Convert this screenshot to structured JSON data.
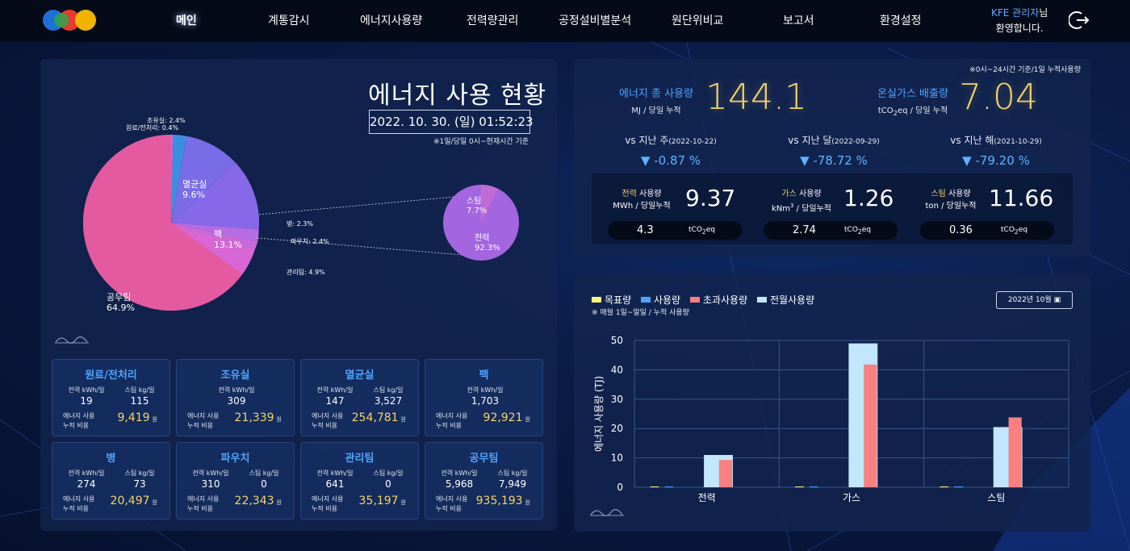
{
  "nav": {
    "items": [
      "메인",
      "계통감시",
      "에너지사용량",
      "전력량관리",
      "공정설비별분석",
      "원단위비교",
      "보고서",
      "환경설정"
    ],
    "active_index": 0
  },
  "user": {
    "name": "KFE 관리자",
    "suffix": "님",
    "greeting": "환영합니다."
  },
  "left_panel": {
    "title": "에너지 사용 현황",
    "date": "2022. 10. 30. (일) 01:52:23",
    "date_note": "※1일/당일 0시~현재시간 기준",
    "pie_labels": {
      "josu": "조유실: 2.4%",
      "wonryo": "원료/전처리: 0.4%",
      "byeong": "병: 2.3%",
      "powchi": "파우치: 2.4%",
      "gwanri": "관리팀: 4.9%",
      "myeol_name": "멸균실",
      "myeol_pct": "9.6%",
      "paek_name": "팩",
      "paek_pct": "13.1%",
      "gongmu_name": "공무팀",
      "gongmu_pct": "64.9%",
      "steam_name": "스팀",
      "steam_pct": "7.7%",
      "power_name": "전력",
      "power_pct": "92.3%"
    },
    "cards": [
      {
        "name": "원료/전처리",
        "power_label": "전력 kWh/일",
        "power": "19",
        "steam_label": "스팀 kg/일",
        "steam": "115",
        "cost_label1": "에너지 사용",
        "cost_label2": "누적 비용",
        "cost": "9,419",
        "won": "원"
      },
      {
        "name": "조유실",
        "power_label": "전력 kWh/일",
        "power": "309",
        "cost_label1": "에너지 사용",
        "cost_label2": "누적 비용",
        "cost": "21,339",
        "won": "원"
      },
      {
        "name": "멸균실",
        "power_label": "전력 kWh/일",
        "power": "147",
        "steam_label": "스팀 kg/일",
        "steam": "3,527",
        "cost_label1": "에너지 사용",
        "cost_label2": "누적 비용",
        "cost": "254,781",
        "won": "원"
      },
      {
        "name": "팩",
        "power_label": "전력 kWh/일",
        "power": "1,703",
        "cost_label1": "에너지 사용",
        "cost_label2": "누적 비용",
        "cost": "92,921",
        "won": "원"
      },
      {
        "name": "병",
        "power_label": "전력 kWh/일",
        "power": "274",
        "steam_label": "스팀 kg/일",
        "steam": "73",
        "cost_label1": "에너지 사용",
        "cost_label2": "누적 비용",
        "cost": "20,497",
        "won": "원"
      },
      {
        "name": "파우치",
        "power_label": "전력 kWh/일",
        "power": "310",
        "steam_label": "스팀 kg/일",
        "steam": "0",
        "cost_label1": "에너지 사용",
        "cost_label2": "누적 비용",
        "cost": "22,343",
        "won": "원"
      },
      {
        "name": "관리팀",
        "power_label": "전력 kWh/일",
        "power": "641",
        "steam_label": "스팀 kg/일",
        "steam": "0",
        "cost_label1": "에너지 사용",
        "cost_label2": "누적 비용",
        "cost": "35,197",
        "won": "원"
      },
      {
        "name": "공무팀",
        "power_label": "전력 kWh/일",
        "power": "5,968",
        "steam_label": "스팀 kg/일",
        "steam": "7,949",
        "cost_label1": "에너지 사용",
        "cost_label2": "누적 비용",
        "cost": "935,193",
        "won": "원"
      }
    ]
  },
  "kpi": {
    "note": "※0시~24시간 기준/1일 누적사용량",
    "total_label": "에너지 총 사용량",
    "total_unit": "MJ / 당일 누적",
    "total_value": "144.1",
    "ghg_label": "온실가스 배출량",
    "ghg_unit_pre": "tCO",
    "ghg_unit_sub": "2",
    "ghg_unit_post": "eq / 당일 누적",
    "ghg_value": "7.04",
    "vs": [
      {
        "label": "vs 지난 주",
        "date": "(2022-10-22)",
        "delta": "▼ -0.87 %"
      },
      {
        "label": "vs 지난 달",
        "date": "(2022-09-29)",
        "delta": "▼ -78.72 %"
      },
      {
        "label": "vs 지난 해",
        "date": "(2021-10-29)",
        "delta": "▼ -79.20 %"
      }
    ],
    "utilities": [
      {
        "name": "전력",
        "suffix": " 사용량",
        "unit": "MWh / 당일누적",
        "value": "9.37",
        "co2": "4.3"
      },
      {
        "name": "가스",
        "suffix": " 사용량",
        "unit_pre": "kNm",
        "unit_sup": "3",
        "unit_post": " / 당일누적",
        "value": "1.26",
        "co2": "2.74"
      },
      {
        "name": "스팀",
        "suffix": " 사용량",
        "unit": "ton / 당일누적",
        "value": "11.66",
        "co2": "0.36"
      }
    ],
    "co2_unit_pre": "tCO",
    "co2_unit_sub": "2",
    "co2_unit_post": "eq"
  },
  "chart_panel": {
    "legend": [
      "목표량",
      "사용량",
      "초과사용량",
      "전월사용량"
    ],
    "legend_colors": [
      "#fff27a",
      "#4fa3ff",
      "#f88080",
      "#c2e6fb"
    ],
    "note": "※ 매월 1일~말일 / 누적 사용량",
    "month_picker": "2022년  10월",
    "calendar_icon": "calendar-icon"
  },
  "chart_data": {
    "type": "bar",
    "categories": [
      "전력",
      "가스",
      "스팀"
    ],
    "ylabel": "에너지 사용량 (TJ)",
    "ylim": [
      0,
      50
    ],
    "yticks": [
      0,
      10,
      20,
      30,
      40,
      50
    ],
    "grid": true,
    "series": [
      {
        "name": "목표량",
        "color": "#fff27a",
        "values": [
          0,
          0,
          0
        ]
      },
      {
        "name": "사용량",
        "color": "#4fa3ff",
        "values": [
          0,
          0,
          0
        ]
      },
      {
        "name": "초과사용량",
        "color": "#f88080",
        "values": [
          9.3,
          41.8,
          23.8
        ]
      },
      {
        "name": "전월사용량",
        "color": "#c2e6fb",
        "values": [
          11.0,
          49.0,
          20.5
        ]
      }
    ]
  }
}
